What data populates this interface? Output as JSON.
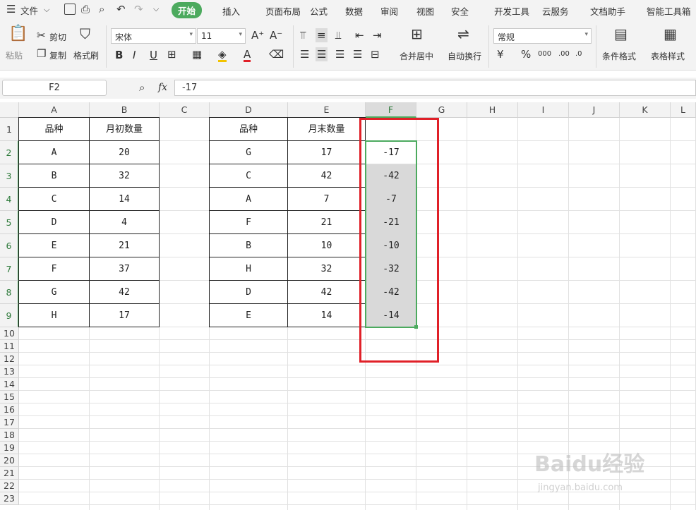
{
  "menu": {
    "file": "文件",
    "tabs": [
      "开始",
      "插入",
      "页面布局",
      "公式",
      "数据",
      "审阅",
      "视图",
      "安全",
      "开发工具",
      "云服务",
      "文档助手",
      "智能工具箱"
    ]
  },
  "ribbon": {
    "paste": "粘贴",
    "cut": "剪切",
    "copy": "复制",
    "format_painter": "格式刷",
    "font_name": "宋体",
    "font_size": "11",
    "merge_center": "合并居中",
    "wrap_text": "自动换行",
    "number_format": "常规",
    "cond_format": "条件格式",
    "table_style": "表格样式"
  },
  "formula_bar": {
    "name_box": "F2",
    "fx": "fx",
    "value": "-17"
  },
  "columns": [
    "A",
    "B",
    "C",
    "D",
    "E",
    "F",
    "G",
    "H",
    "I",
    "J",
    "K",
    "L"
  ],
  "rows": [
    "1",
    "2",
    "3",
    "4",
    "5",
    "6",
    "7",
    "8",
    "9",
    "10",
    "11",
    "12",
    "13",
    "14",
    "15",
    "16",
    "17",
    "18",
    "19",
    "20",
    "21",
    "22",
    "23"
  ],
  "table1": {
    "headers": [
      "品种",
      "月初数量"
    ],
    "rows": [
      [
        "A",
        "20"
      ],
      [
        "B",
        "32"
      ],
      [
        "C",
        "14"
      ],
      [
        "D",
        "4"
      ],
      [
        "E",
        "21"
      ],
      [
        "F",
        "37"
      ],
      [
        "G",
        "42"
      ],
      [
        "H",
        "17"
      ]
    ]
  },
  "table2": {
    "headers": [
      "品种",
      "月末数量"
    ],
    "rows": [
      [
        "G",
        "17"
      ],
      [
        "C",
        "42"
      ],
      [
        "A",
        "7"
      ],
      [
        "F",
        "21"
      ],
      [
        "B",
        "10"
      ],
      [
        "H",
        "32"
      ],
      [
        "D",
        "42"
      ],
      [
        "E",
        "14"
      ]
    ]
  },
  "colF": [
    "-17",
    "-42",
    "-7",
    "-21",
    "-10",
    "-32",
    "-42",
    "-14"
  ],
  "watermark": {
    "logo": "Baidu经验",
    "url": "jingyan.baidu.com"
  },
  "colors": {
    "accent": "#4caa5e",
    "highlight": "#e02028",
    "selected_fill": "#d9d9d9"
  }
}
